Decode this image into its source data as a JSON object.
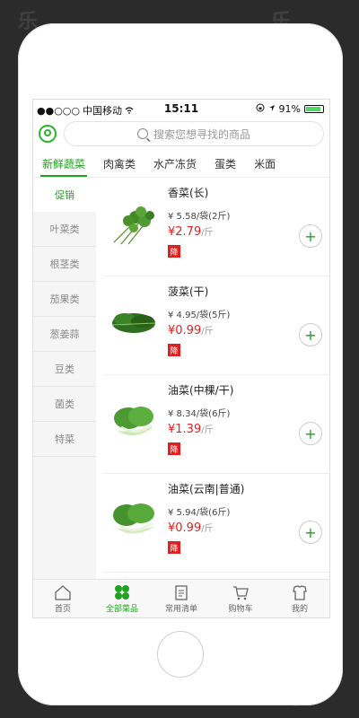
{
  "watermark": {
    "text": "乐"
  },
  "statusbar": {
    "signal": "●●○○○",
    "carrier": "中国移动",
    "time": "15:11",
    "battery_text": "91%",
    "battery_level": 0.91
  },
  "search": {
    "placeholder": "搜索您想寻找的商品"
  },
  "category_tabs": [
    {
      "label": "新鲜蔬菜",
      "active": true
    },
    {
      "label": "肉禽类"
    },
    {
      "label": "水产冻货"
    },
    {
      "label": "蛋类"
    },
    {
      "label": "米面"
    }
  ],
  "side_nav": [
    {
      "label": "促销",
      "active": true
    },
    {
      "label": "叶菜类"
    },
    {
      "label": "根茎类"
    },
    {
      "label": "茄果类"
    },
    {
      "label": "葱姜蒜"
    },
    {
      "label": "豆类"
    },
    {
      "label": "菌类"
    },
    {
      "label": "特菜"
    }
  ],
  "products": [
    {
      "name": "香菜(长)",
      "pack": "¥ 5.58/袋(2斤)",
      "price": "¥2.79",
      "unit": "/斤",
      "badge": "降",
      "add": "+"
    },
    {
      "name": "菠菜(干)",
      "pack": "¥ 4.95/袋(5斤)",
      "price": "¥0.99",
      "unit": "/斤",
      "badge": "降",
      "add": "+"
    },
    {
      "name": "油菜(中棵/干)",
      "pack": "¥ 8.34/袋(6斤)",
      "price": "¥1.39",
      "unit": "/斤",
      "badge": "降",
      "add": "+"
    },
    {
      "name": "油菜(云南|普通)",
      "pack": "¥ 5.94/袋(6斤)",
      "price": "¥0.99",
      "unit": "/斤",
      "badge": "降",
      "add": "+"
    }
  ],
  "tabbar": [
    {
      "label": "首页",
      "icon": "home-icon"
    },
    {
      "label": "全部菜品",
      "icon": "grid-icon",
      "active": true
    },
    {
      "label": "常用清单",
      "icon": "clipboard-icon"
    },
    {
      "label": "购物车",
      "icon": "cart-icon"
    },
    {
      "label": "我的",
      "icon": "profile-icon"
    }
  ],
  "colors": {
    "accent": "#1fa21f",
    "price": "#e02020"
  }
}
